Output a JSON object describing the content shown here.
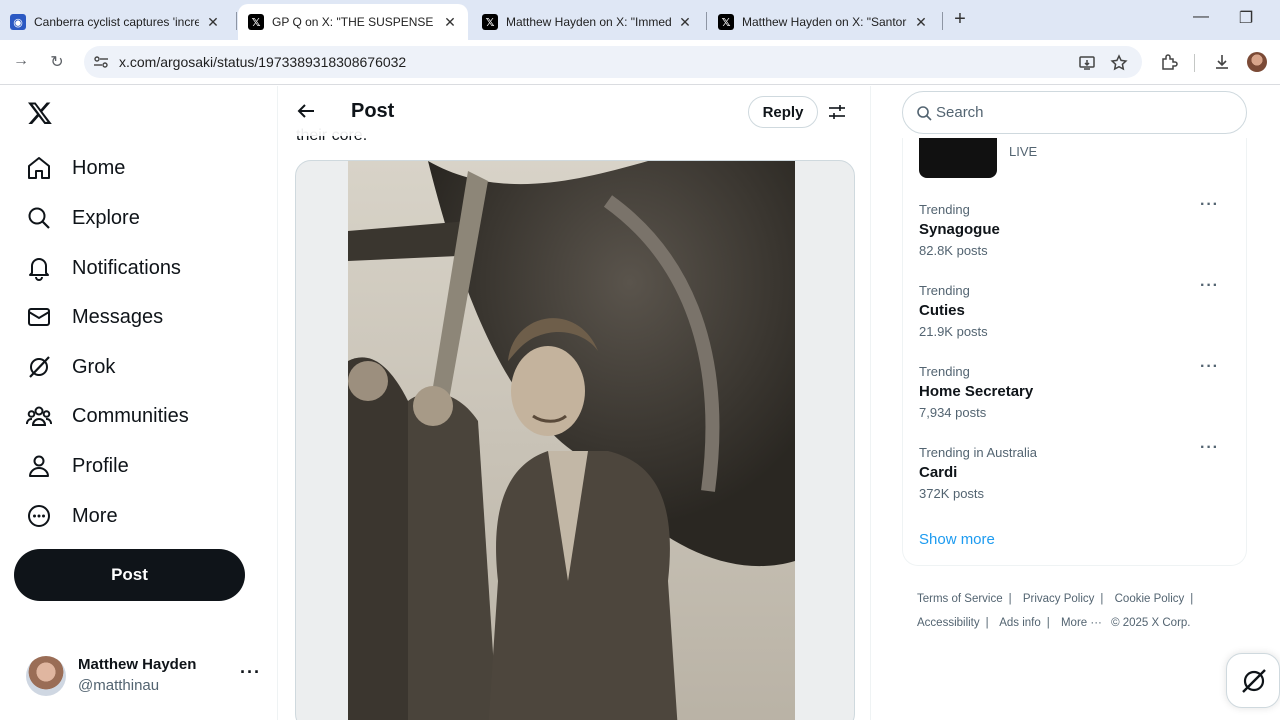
{
  "browser": {
    "tabs": [
      {
        "title": "Canberra cyclist captures 'incre",
        "favicon": "abc-icon",
        "active": false
      },
      {
        "title": "GP Q on X: \"THE SUSPENSE 😱 (",
        "favicon": "x-icon",
        "active": true
      },
      {
        "title": "Matthew Hayden on X: \"Immed",
        "favicon": "x-icon",
        "active": false
      },
      {
        "title": "Matthew Hayden on X: \"Santor",
        "favicon": "x-icon",
        "active": false
      }
    ],
    "url": "x.com/argosaki/status/1973389318308676032"
  },
  "nav": {
    "items": [
      {
        "label": "Home",
        "icon": "home-icon"
      },
      {
        "label": "Explore",
        "icon": "search-icon"
      },
      {
        "label": "Notifications",
        "icon": "bell-icon"
      },
      {
        "label": "Messages",
        "icon": "mail-icon"
      },
      {
        "label": "Grok",
        "icon": "grok-icon"
      },
      {
        "label": "Communities",
        "icon": "communities-icon"
      },
      {
        "label": "Profile",
        "icon": "person-icon"
      },
      {
        "label": "More",
        "icon": "more-circle-icon"
      }
    ],
    "post_label": "Post"
  },
  "account": {
    "name": "Matthew Hayden",
    "handle": "@matthinau"
  },
  "post": {
    "title": "Post",
    "reply_label": "Reply",
    "text_snippet": "their core."
  },
  "sidebar": {
    "search_placeholder": "Search",
    "live_label": "LIVE",
    "trends": [
      {
        "category": "Trending",
        "name": "Synagogue",
        "count": "82.8K posts"
      },
      {
        "category": "Trending",
        "name": "Cuties",
        "count": "21.9K posts"
      },
      {
        "category": "Trending",
        "name": "Home Secretary",
        "count": "7,934 posts"
      },
      {
        "category": "Trending in Australia",
        "name": "Cardi",
        "count": "372K posts"
      }
    ],
    "show_more": "Show more",
    "footer_links": [
      "Terms of Service",
      "Privacy Policy",
      "Cookie Policy",
      "Accessibility",
      "Ads info",
      "More ···",
      "© 2025 X Corp."
    ]
  }
}
